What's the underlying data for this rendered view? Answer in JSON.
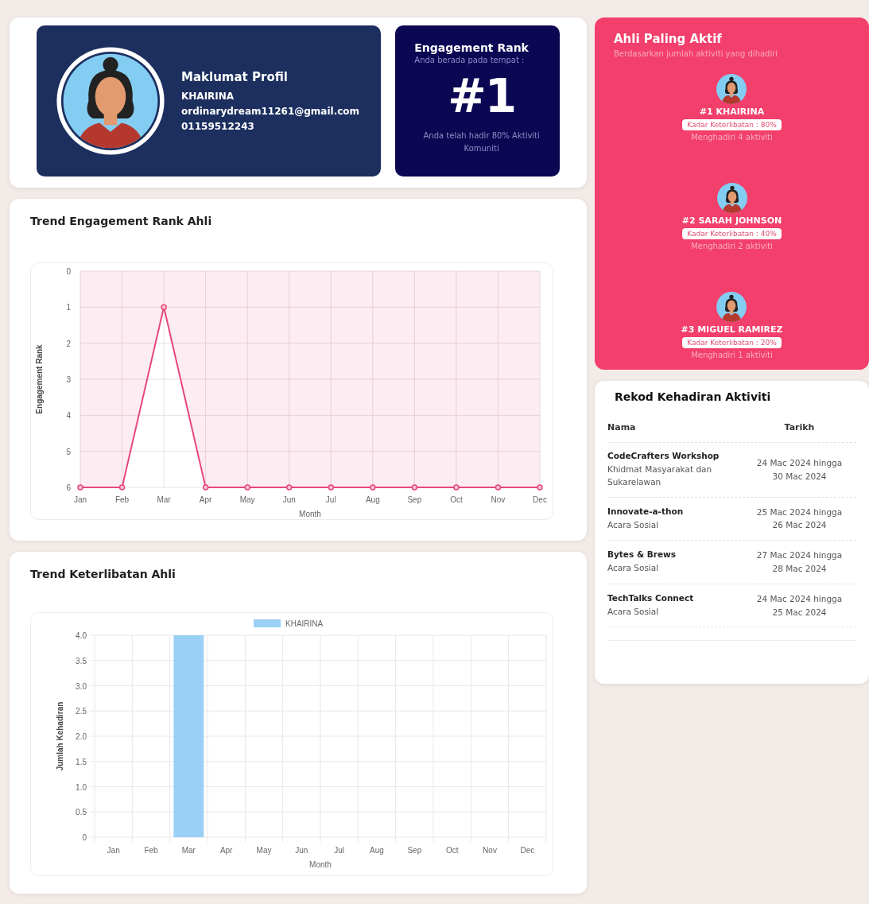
{
  "profile": {
    "title": "Maklumat Profil",
    "name": "KHAIRINA",
    "email": "ordinarydream11261@gmail.com",
    "phone": "01159512243"
  },
  "rank_card": {
    "title": "Engagement Rank",
    "subtitle": "Anda berada pada tempat :",
    "rank": "#1",
    "note": "Anda telah hadir 80% Aktiviti Komuniti"
  },
  "rank_trend": {
    "title": "Trend Engagement Rank Ahli",
    "chart_data": {
      "type": "line",
      "xlabel": "Month",
      "ylabel": "Engagement Rank",
      "categories": [
        "Jan",
        "Feb",
        "Mar",
        "Apr",
        "May",
        "Jun",
        "Jul",
        "Aug",
        "Sep",
        "Oct",
        "Nov",
        "Dec"
      ],
      "series": [
        {
          "color": "#e8477a",
          "marker": true,
          "values": [
            6,
            6,
            1,
            6,
            6,
            6,
            6,
            6,
            6,
            6,
            6,
            6
          ]
        }
      ],
      "grid": true,
      "ylim": [
        6,
        0
      ],
      "yticks": [
        0,
        1,
        2,
        3,
        4,
        5,
        6
      ]
    }
  },
  "engagement_trend": {
    "title": "Trend Keterlibatan Ahli",
    "chart_data": {
      "type": "bar",
      "xlabel": "Month",
      "ylabel": "Jumlah Kehadiran",
      "categories": [
        "Jan",
        "Feb",
        "Mar",
        "Apr",
        "May",
        "Jun",
        "Jul",
        "Aug",
        "Sep",
        "Oct",
        "Nov",
        "Dec"
      ],
      "series": [
        {
          "name": "KHAIRINA",
          "color": "#9ad0f5",
          "values": [
            0,
            0,
            4,
            0,
            0,
            0,
            0,
            0,
            0,
            0,
            0,
            0
          ]
        }
      ],
      "grid": true,
      "ylim": [
        0,
        4
      ],
      "yticks": [
        0,
        {
          "value": 0.5,
          "label": "0.5"
        },
        {
          "value": 1,
          "label": "1.0"
        },
        {
          "value": 1.5,
          "label": "1.5"
        },
        {
          "value": 2,
          "label": "2.0"
        },
        {
          "value": 2.5,
          "label": "2.5"
        },
        {
          "value": 3,
          "label": "3.0"
        },
        {
          "value": 3.5,
          "label": "3.5"
        },
        {
          "value": 4,
          "label": "4.0"
        }
      ]
    }
  },
  "top_members": {
    "title": "Ahli Paling Aktif",
    "subtitle": "Berdasarkan jumlah aktiviti yang dihadiri",
    "members": [
      {
        "name": "#1 KHAIRINA",
        "rate": "Kadar Keterlibatan : 80%",
        "attended": "Menghadiri 4 aktiviti"
      },
      {
        "name": "#2 SARAH JOHNSON",
        "rate": "Kadar Keterlibatan : 40%",
        "attended": "Menghadiri 2 aktiviti"
      },
      {
        "name": "#3 MIGUEL RAMIREZ",
        "rate": "Kadar Keterlibatan : 20%",
        "attended": "Menghadiri 1 aktiviti"
      }
    ]
  },
  "attendance": {
    "title": "Rekod Kehadiran Aktiviti",
    "columns": [
      "Nama",
      "Tarikh"
    ],
    "rows": [
      {
        "name": "CodeCrafters Workshop",
        "category": "Khidmat Masyarakat dan Sukarelawan",
        "date": "24 Mac 2024 hingga 30 Mac 2024"
      },
      {
        "name": "Innovate-a-thon",
        "category": "Acara Sosial",
        "date": "25 Mac 2024 hingga 26 Mac 2024"
      },
      {
        "name": "Bytes & Brews",
        "category": "Acara Sosial",
        "date": "27 Mac 2024 hingga 28 Mac 2024"
      },
      {
        "name": "TechTalks Connect",
        "category": "Acara Sosial",
        "date": "24 Mac 2024 hingga 25 Mac 2024"
      }
    ]
  }
}
